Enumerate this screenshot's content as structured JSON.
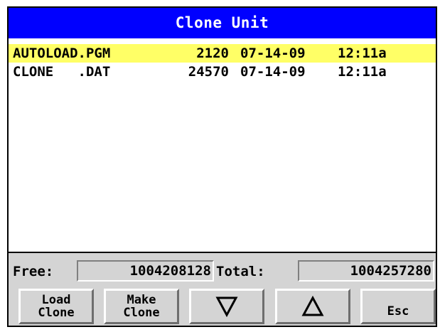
{
  "title": "Clone Unit",
  "files": [
    {
      "name": "AUTOLOAD.PGM",
      "size": "2120",
      "date": "07-14-09",
      "time": "12:11a",
      "selected": true
    },
    {
      "name": "CLONE   .DAT",
      "size": "24570",
      "date": "07-14-09",
      "time": "12:11a",
      "selected": false
    }
  ],
  "status": {
    "free_label": "Free:",
    "free_value": "1004208128",
    "total_label": "Total:",
    "total_value": "1004257280"
  },
  "buttons": {
    "load_clone": {
      "line1": "Load",
      "line2": "Clone"
    },
    "make_clone": {
      "line1": "Make",
      "line2": "Clone"
    },
    "down_icon": "down-triangle-icon",
    "up_icon": "up-triangle-icon",
    "esc": "Esc"
  },
  "colors": {
    "title_bg": "#0000ff",
    "title_fg": "#ffffff",
    "selected_row": "#ffff66",
    "panel_bg": "#d4d4d4"
  }
}
